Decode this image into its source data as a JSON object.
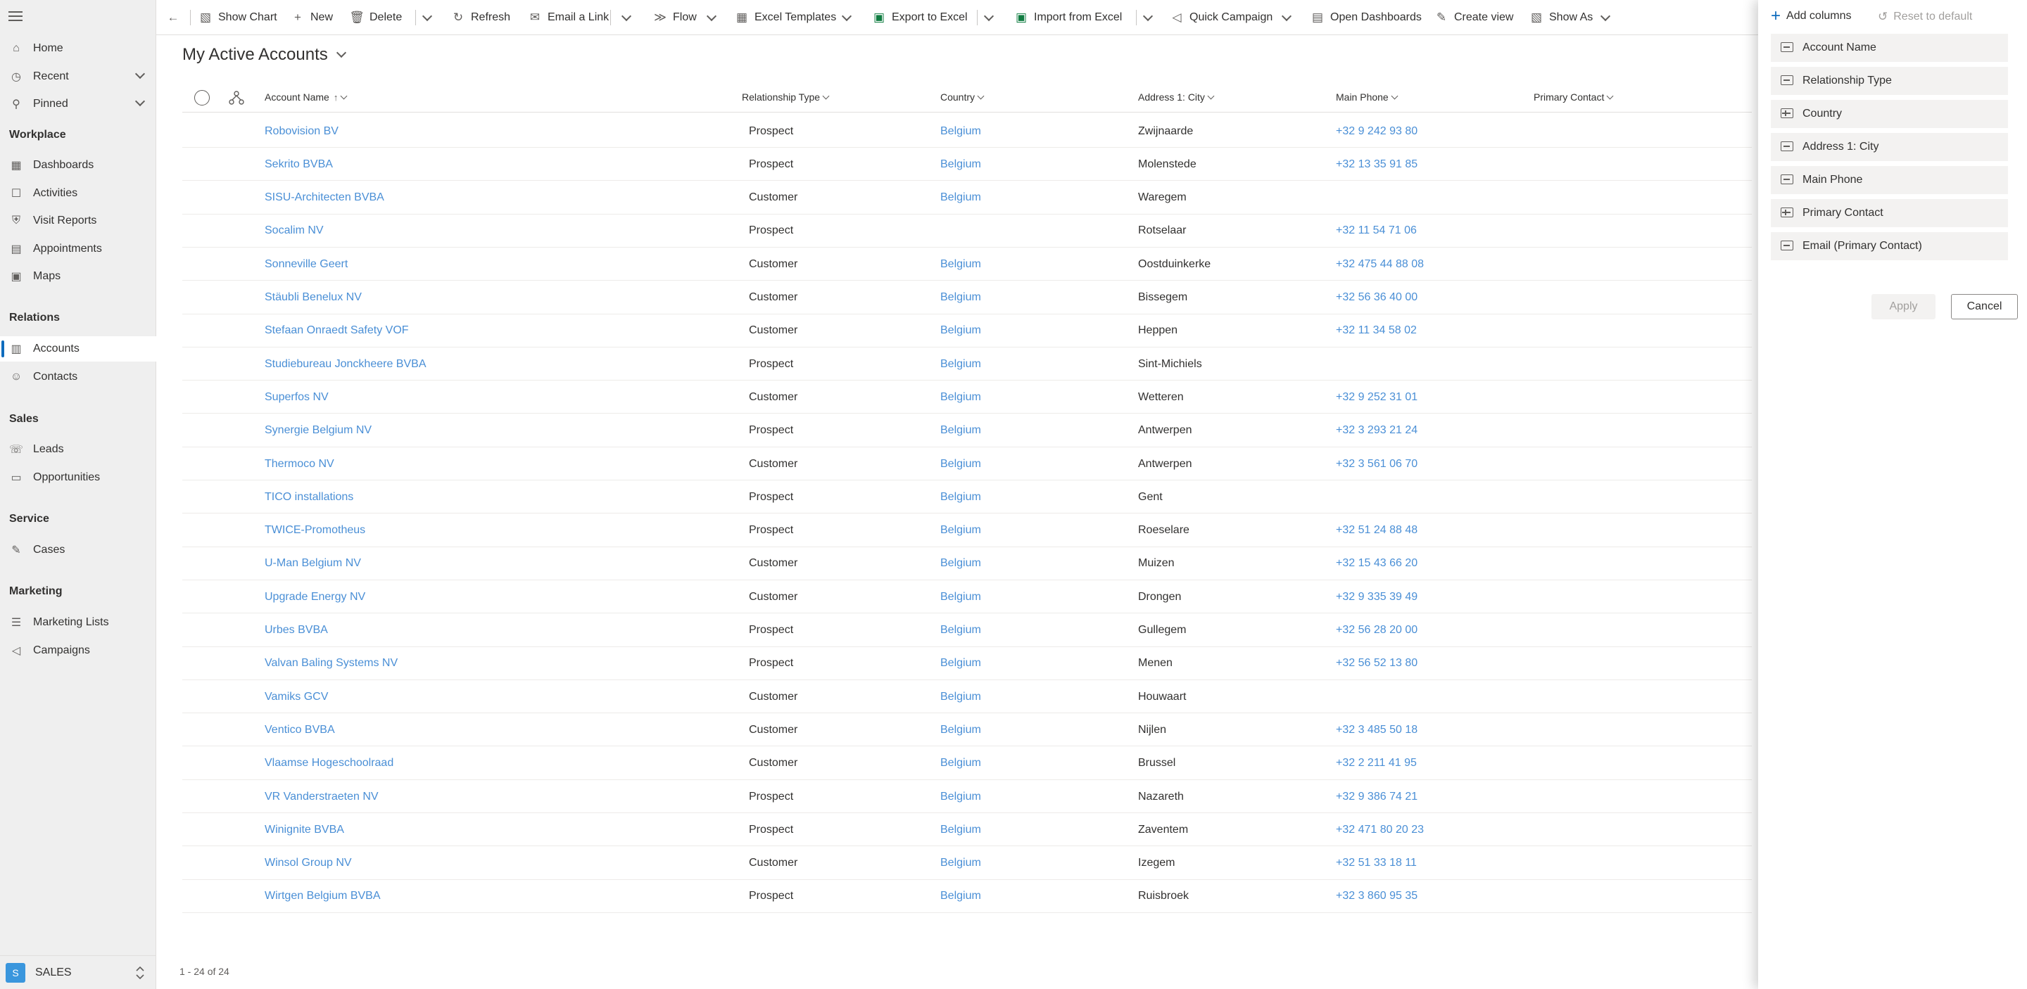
{
  "sidebar": {
    "home": "Home",
    "recent": "Recent",
    "pinned": "Pinned",
    "sections": {
      "workplace": "Workplace",
      "relations": "Relations",
      "sales": "Sales",
      "service": "Service",
      "marketing": "Marketing"
    },
    "items": {
      "dashboards": "Dashboards",
      "activities": "Activities",
      "visit_reports": "Visit Reports",
      "appointments": "Appointments",
      "maps": "Maps",
      "accounts": "Accounts",
      "contacts": "Contacts",
      "leads": "Leads",
      "opportunities": "Opportunities",
      "cases": "Cases",
      "marketing_lists": "Marketing Lists",
      "campaigns": "Campaigns"
    },
    "area": {
      "badge": "S",
      "name": "SALES"
    }
  },
  "commands": {
    "show_chart": "Show Chart",
    "new": "New",
    "delete": "Delete",
    "refresh": "Refresh",
    "email_link": "Email a Link",
    "flow": "Flow",
    "excel_templates": "Excel Templates",
    "export_excel": "Export to Excel",
    "import_excel": "Import from Excel",
    "quick_campaign": "Quick Campaign",
    "open_dashboards": "Open Dashboards",
    "create_view": "Create view",
    "show_as": "Show As"
  },
  "view": {
    "title": "My Active Accounts"
  },
  "columns": {
    "account_name": "Account Name",
    "relationship_type": "Relationship Type",
    "country": "Country",
    "city": "Address 1: City",
    "main_phone": "Main Phone",
    "primary_contact": "Primary Contact",
    "sort_arrow": "↑"
  },
  "rows": [
    {
      "name": "Robovision BV",
      "type": "Prospect",
      "country": "Belgium",
      "city": "Zwijnaarde",
      "phone": "+32 9 242 93 80"
    },
    {
      "name": "Sekrito BVBA",
      "type": "Prospect",
      "country": "Belgium",
      "city": "Molenstede",
      "phone": "+32 13 35 91 85"
    },
    {
      "name": "SISU-Architecten BVBA",
      "type": "Customer",
      "country": "Belgium",
      "city": "Waregem",
      "phone": ""
    },
    {
      "name": "Socalim NV",
      "type": "Prospect",
      "country": "",
      "city": "Rotselaar",
      "phone": "+32 11 54 71 06"
    },
    {
      "name": "Sonneville Geert",
      "type": "Customer",
      "country": "Belgium",
      "city": "Oostduinkerke",
      "phone": "+32 475 44 88 08"
    },
    {
      "name": "Stäubli Benelux NV",
      "type": "Customer",
      "country": "Belgium",
      "city": "Bissegem",
      "phone": "+32 56 36 40 00"
    },
    {
      "name": "Stefaan Onraedt Safety VOF",
      "type": "Customer",
      "country": "Belgium",
      "city": "Heppen",
      "phone": "+32 11 34 58 02"
    },
    {
      "name": "Studiebureau Jonckheere BVBA",
      "type": "Prospect",
      "country": "Belgium",
      "city": "Sint-Michiels",
      "phone": ""
    },
    {
      "name": "Superfos NV",
      "type": "Customer",
      "country": "Belgium",
      "city": "Wetteren",
      "phone": "+32 9 252 31 01"
    },
    {
      "name": "Synergie Belgium NV",
      "type": "Prospect",
      "country": "Belgium",
      "city": "Antwerpen",
      "phone": "+32 3 293 21 24"
    },
    {
      "name": "Thermoco NV",
      "type": "Customer",
      "country": "Belgium",
      "city": "Antwerpen",
      "phone": "+32 3 561 06 70"
    },
    {
      "name": "TICO installations",
      "type": "Prospect",
      "country": "Belgium",
      "city": "Gent",
      "phone": ""
    },
    {
      "name": "TWICE-Promotheus",
      "type": "Prospect",
      "country": "Belgium",
      "city": "Roeselare",
      "phone": "+32 51 24 88 48"
    },
    {
      "name": "U-Man Belgium NV",
      "type": "Customer",
      "country": "Belgium",
      "city": "Muizen",
      "phone": "+32 15 43 66 20"
    },
    {
      "name": "Upgrade Energy NV",
      "type": "Customer",
      "country": "Belgium",
      "city": "Drongen",
      "phone": "+32 9 335 39 49"
    },
    {
      "name": "Urbes BVBA",
      "type": "Prospect",
      "country": "Belgium",
      "city": "Gullegem",
      "phone": "+32 56 28 20 00"
    },
    {
      "name": "Valvan Baling Systems NV",
      "type": "Prospect",
      "country": "Belgium",
      "city": "Menen",
      "phone": "+32 56 52 13 80"
    },
    {
      "name": "Vamiks GCV",
      "type": "Customer",
      "country": "Belgium",
      "city": "Houwaart",
      "phone": ""
    },
    {
      "name": "Ventico BVBA",
      "type": "Customer",
      "country": "Belgium",
      "city": "Nijlen",
      "phone": "+32 3 485 50 18"
    },
    {
      "name": "Vlaamse Hogeschoolraad",
      "type": "Customer",
      "country": "Belgium",
      "city": "Brussel",
      "phone": "+32 2 211 41 95"
    },
    {
      "name": "VR Vanderstraeten NV",
      "type": "Prospect",
      "country": "Belgium",
      "city": "Nazareth",
      "phone": "+32 9 386 74 21"
    },
    {
      "name": "Winignite BVBA",
      "type": "Prospect",
      "country": "Belgium",
      "city": "Zaventem",
      "phone": "+32 471 80 20 23"
    },
    {
      "name": "Winsol Group NV",
      "type": "Customer",
      "country": "Belgium",
      "city": "Izegem",
      "phone": "+32 51 33 18 11"
    },
    {
      "name": "Wirtgen Belgium BVBA",
      "type": "Prospect",
      "country": "Belgium",
      "city": "Ruisbroek",
      "phone": "+32 3 860 95 35"
    }
  ],
  "footer": {
    "count": "1 - 24 of 24"
  },
  "panel": {
    "add_columns": "Add columns",
    "reset": "Reset to default",
    "columns": [
      {
        "label": "Account Name",
        "icon": "text-field-icon"
      },
      {
        "label": "Relationship Type",
        "icon": "option-set-icon"
      },
      {
        "label": "Country",
        "icon": "lookup-icon"
      },
      {
        "label": "Address 1: City",
        "icon": "text-field-icon"
      },
      {
        "label": "Main Phone",
        "icon": "text-field-icon"
      },
      {
        "label": "Primary Contact",
        "icon": "lookup-icon"
      },
      {
        "label": "Email (Primary Contact)",
        "icon": "text-field-icon"
      }
    ],
    "apply": "Apply",
    "cancel": "Cancel"
  },
  "colors": {
    "accent": "#0f6cbd",
    "link": "#4a8fd6",
    "sidebar_bg": "#efefef"
  }
}
